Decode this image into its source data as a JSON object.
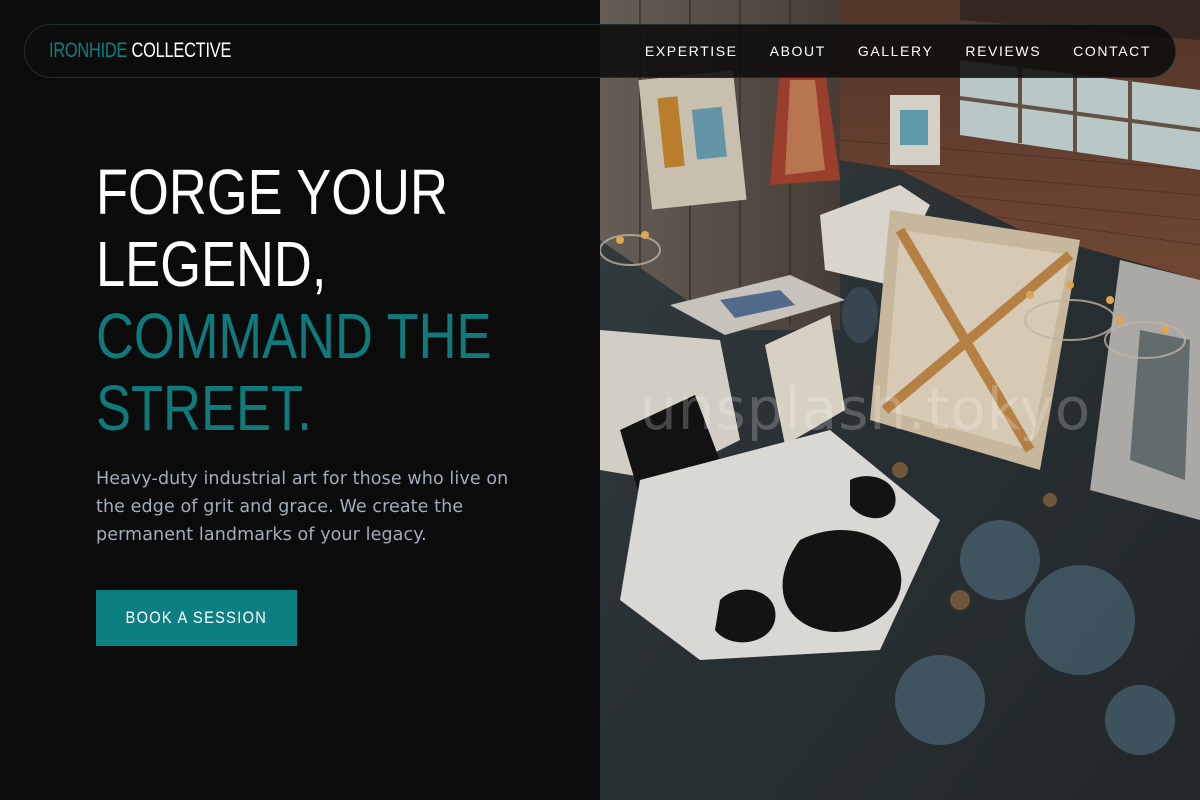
{
  "nav": {
    "brand_primary": "IRONHIDE",
    "brand_secondary": "COLLECTIVE",
    "links": [
      "EXPERTISE",
      "ABOUT",
      "GALLERY",
      "REVIEWS",
      "CONTACT"
    ]
  },
  "hero": {
    "headline_lines": [
      "FORGE YOUR",
      "LEGEND,"
    ],
    "headline_accent_lines": [
      "COMMAND THE",
      "STREET."
    ],
    "tagline": "Heavy-duty industrial art for those who live on the edge of grit and grace. We create the permanent landmarks of your legacy.",
    "cta_label": "BOOK A SESSION"
  },
  "photo": {
    "watermark": "unsplash.tokyo"
  },
  "colors": {
    "accent": "#0c7f82",
    "background": "#0b0b0b",
    "text_muted": "#a3acbb"
  }
}
